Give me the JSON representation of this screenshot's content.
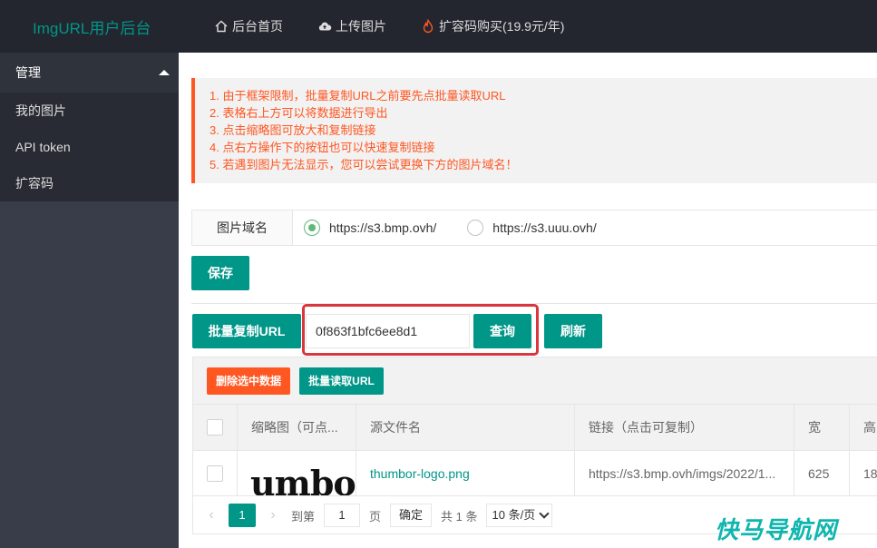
{
  "header": {
    "logo": "ImgURL用户后台",
    "nav": [
      {
        "label": "后台首页",
        "icon": "home-icon"
      },
      {
        "label": "上传图片",
        "icon": "cloud-upload-icon"
      },
      {
        "label": "扩容码购买(19.9元/年)",
        "icon": "fire-icon"
      }
    ]
  },
  "sidebar": {
    "group": "管理",
    "items": [
      "我的图片",
      "API token",
      "扩容码"
    ]
  },
  "notice": [
    "1. 由于框架限制，批量复制URL之前要先点批量读取URL",
    "2. 表格右上方可以将数据进行导出",
    "3. 点击缩略图可放大和复制链接",
    "4. 点右方操作下的按钮也可以快速复制链接",
    "5. 若遇到图片无法显示，您可以尝试更换下方的图片域名！"
  ],
  "domain": {
    "label": "图片域名",
    "options": [
      "https://s3.bmp.ovh/",
      "https://s3.uuu.ovh/"
    ],
    "selected": 0
  },
  "buttons": {
    "save": "保存",
    "batch_copy": "批量复制URL",
    "query": "查询",
    "refresh": "刷新",
    "delete_selected": "删除选中数据",
    "batch_read": "批量读取URL"
  },
  "search": {
    "value": "0f863f1bfc6ee8d1"
  },
  "table": {
    "columns": [
      "缩略图（可点...",
      "源文件名",
      "链接（点击可复制）",
      "宽",
      "高"
    ],
    "rows": [
      {
        "thumb": "umbo",
        "filename": "thumbor-logo.png",
        "link": "https://s3.bmp.ovh/imgs/2022/1...",
        "width": "625",
        "height": "18"
      }
    ]
  },
  "pager": {
    "current": "1",
    "goto_prefix": "到第",
    "goto_value": "1",
    "page_suffix": "页",
    "confirm": "确定",
    "total": "共 1 条",
    "page_size": "10 条/页"
  },
  "watermark": "快马导航网",
  "colors": {
    "primary": "#009688",
    "danger": "#ff5722",
    "header_bg": "#23262e",
    "sidebar_bg": "#393d49",
    "highlight": "#d9363e"
  }
}
